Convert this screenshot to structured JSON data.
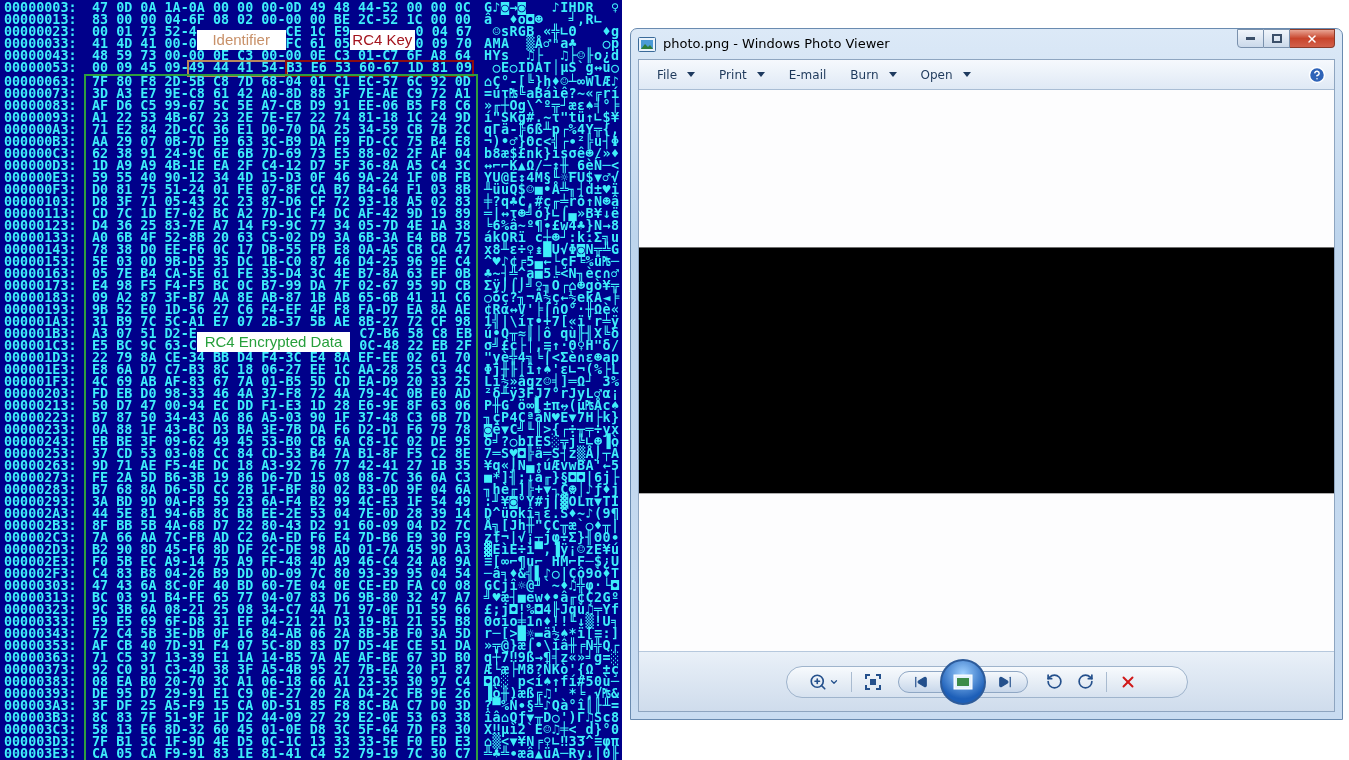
{
  "hex_dump": {
    "rows": [
      {
        "offset": "00000003:",
        "hex": "47 0D 0A 1A-0A 00 00 00-0D 49 48 44-52 00 00 0C",
        "ascii": "G♪◙→◙   ♪IHDR  ♀"
      },
      {
        "offset": "00000013:",
        "hex": "83 00 00 04-6F 08 02 00-00 00 BE 2C-52 1C 00 00",
        "ascii": "â  ♦o◘☻   ╛,R∟  "
      },
      {
        "offset": "00000023:",
        "hex": [
          {
            "kind": "text",
            "text": "00 01 73 52-4"
          },
          {
            "kind": "label",
            "text": "Identifier",
            "color": "#c89068"
          },
          {
            "kind": "text",
            "text": "CE 1C E9"
          },
          {
            "kind": "label",
            "text": "RC4 Key",
            "color": "#a3121c"
          },
          {
            "kind": "text",
            "text": "0 04 67"
          }
        ],
        "ascii": " ☺sRGB «╬∟Θ   ♦g"
      },
      {
        "offset": "00000033:",
        "hex": [
          {
            "kind": "text",
            "text": "41 4D 41 00-0"
          },
          {
            "kind": "covered"
          },
          {
            "kind": "text",
            "text": "FC 61 05"
          },
          {
            "kind": "covered"
          },
          {
            "kind": "text",
            "text": "0 09 70"
          }
        ],
        "ascii": "AMA  ▒Å♂ⁿa♣   ○p"
      },
      {
        "offset": "00000043:",
        "hex": "48 59 73 00-00 0E C3 00-00 0E C3 01-C7 6F A8 64",
        "ascii": "HYs  ♫├  ♫├☺╟o¿d"
      },
      {
        "offset": "00000053:",
        "hex": [
          {
            "kind": "text",
            "text": "00 09 45 09-"
          },
          {
            "kind": "boxed",
            "text": "49 44 41 54-",
            "color": "#b8875c"
          },
          {
            "kind": "boxed",
            "text": "B3 E6 53 60-67 1D 81 09",
            "color": "#8b0d12"
          }
        ],
        "ascii": " ○E○IDAT│µS`g↔ü○"
      },
      {
        "offset": "00000063:",
        "hex": "7F 80 F8 2D-5B C8 7D 68-04 01 C1 EC-57 6C 92 0D",
        "ascii": "⌂Ç°-[╚}h♦☺┴∞WlÆ♪"
      },
      {
        "offset": "00000073:",
        "hex": "3D A3 E7 9E-C8 61 42 A0-8D 88 3F 7E-AE C9 72 A1",
        "ascii": "=úτ₧╚aBáìê?~«╔rí"
      },
      {
        "offset": "00000083:",
        "hex": "AF D6 C5 99-67 5C 5E A7-CB D9 91 EE-06 B5 F8 C6",
        "ascii": "»╓┼Ög\\^º╦┘æε♠╡°╞"
      },
      {
        "offset": "00000093:",
        "hex": "A1 22 53 4B-67 23 2E 7E-E7 22 74 81-18 1C 24 9D",
        "ascii": "í\"SKg#.~τ\"tü↑∟$¥"
      },
      {
        "offset": "000000A3:",
        "hex": "71 E2 84 2D-CC 36 E1 D0-70 DA 25 34-59 CB 7B 2C",
        "ascii": "qΓä-╠6ß╨p┌%4Y╦{,"
      },
      {
        "offset": "000000B3:",
        "hex": "AA 29 07 0B-7D E9 63 3C-B9 DA F9 FD-CC 75 B4 E8",
        "ascii": "¬)•♂}Θc<╣┌∙²╠u┤Φ"
      },
      {
        "offset": "000000C3:",
        "hex": "62 38 91 24-9C 6E 6B 7D-69 73 E5 88-02 2F AF 04",
        "ascii": "b8æ$£nk}isσê☻/»♦"
      },
      {
        "offset": "000000D3:",
        "hex": "1D A9 A9 4B-1E EA 2F C4-12 D7 5F 36-8A A5 C4 3C",
        "ascii": "↔⌐⌐K▲Ω/─↕╫_6èÑ─<"
      },
      {
        "offset": "000000E3:",
        "hex": "59 55 40 90-12 34 4D 15-D3 0F 46 9A-24 1F 0B FB",
        "ascii": "YU@É↕4M§╙☼FÜ$▼♂√"
      },
      {
        "offset": "000000F3:",
        "hex": "D0 81 75 51-24 01 FE 07-8F CA B7 B4-64 F1 03 8B",
        "ascii": "╨üuQ$☺■•Å╩╖┤d±♥ï"
      },
      {
        "offset": "00000103:",
        "hex": "D8 3F 71 05-43 2C 23 87-D6 CF 72 93-18 A5 02 83",
        "ascii": "╪?q♣C,#ç╓╧rô↑Ñ☻â"
      },
      {
        "offset": "00000113:",
        "hex": "CD 7C 1D E7-02 BC A2 7D-1C F4 DC AF-42 9D 19 89",
        "ascii": "═|↔τ☻╝ó}∟⌠▄»B¥↓ë"
      },
      {
        "offset": "00000123:",
        "hex": "D4 36 25 83-7E A7 14 F9-9C 77 34 05-7D 4E 1A 38",
        "ascii": "╘6%â~º¶∙£w4♣}N→8"
      },
      {
        "offset": "00000133:",
        "hex": "A0 6B 4F 52-8B 20 63 C5-02 D9 3A 6B-3A E4 BB 75",
        "ascii": "ákORï c┼☻┘:k:Σ╗u"
      },
      {
        "offset": "00000143:",
        "hex": "78 38 D0 EE-F6 0C 17 DB-55 FB E8 0A-A5 CB CA 47",
        "ascii": "x8╨ε÷♀↨█U√Φ◙Ñ╦╩G"
      },
      {
        "offset": "00000153:",
        "hex": "5E 03 0D 9B-D5 35 DC 1B-C0 87 46 D4-25 96 9E C4",
        "ascii": "^♥♪¢╒5▄←└çF╘%û₧─"
      },
      {
        "offset": "00000163:",
        "hex": "05 7E B4 CA-5E 61 FE 35-D4 3C 4E B7-8A 63 EF 0B",
        "ascii": "♣~┤╩^a■5╘<N╖èc∩♂"
      },
      {
        "offset": "00000173:",
        "hex": "E4 98 F5 F4-F5 BC 0C B7-99 DA 7F 02-67 95 9D CB",
        "ascii": "Σÿ⌡⌠⌡╝♀╖Ö┌⌂☻gò¥╦"
      },
      {
        "offset": "00000183:",
        "hex": "09 A2 87 3F-B7 AA 8E AB-87 1B AB 65-6B 41 11 C6",
        "ascii": "○óç?╖¬Ä½ç←½ekA◄╞"
      },
      {
        "offset": "00000193:",
        "hex": "9B 52 E0 1D-56 27 C6 F4-EF 4F F8 FA-D7 EA 8A AE",
        "ascii": "¢Rα↔V'╞⌠∩O°·╫Ωè«"
      },
      {
        "offset": "000001A3:",
        "hex": "31 B9 7C 5C-A1 E7 07 2B-37 5B AE 8B-27 72 CF 98",
        "ascii": "1╣|\\íτ•+7[«ï'r╧ÿ"
      },
      {
        "offset": "000001B3:",
        "hex": [
          {
            "kind": "text",
            "text": "A3 07 51 D2-E"
          },
          {
            "kind": "label",
            "text": "RC4 Encrypted Data",
            "color": "#27a03c"
          },
          {
            "kind": "text",
            "text": "C7-B6 58 C8 EB"
          }
        ],
        "ascii": "ú•Q╥≈║│ô qù╟╢X╚δ"
      },
      {
        "offset": "000001C3:",
        "hex": [
          {
            "kind": "text",
            "text": "E5 BC 9C 63-C"
          },
          {
            "kind": "covered"
          },
          {
            "kind": "text",
            "text": "0C-48 22 EB 2F"
          }
        ],
        "ascii": "σ╝£c├│,≡↑·Θ♀H\"δ/"
      },
      {
        "offset": "000001D3:",
        "hex": "22 79 8A CE-34 BB D4 F4-3C E4 8A EF-EE 02 61 70",
        "ascii": "\"yè╬4╗╘⌠<Σè∩ε☻ap"
      },
      {
        "offset": "000001E3:",
        "hex": "E8 6A D7 C7-B3 8C 18 06-27 EE 1C AA-28 25 C3 4C",
        "ascii": "Φj╫╟│î↑♠'ε∟¬(%├L"
      },
      {
        "offset": "000001F3:",
        "hex": "4C 69 AB AF-83 67 7A 01-B5 5D CD EA-D9 20 33 25",
        "ascii": "Li½»âgz☺╡]═Ω┘ 3%"
      },
      {
        "offset": "00000203:",
        "hex": "FD EB D0 98-33 46 4A 37-F8 72 4A 79-4C 0B E0 AD",
        "ascii": "²δ╨ÿ3FJ7°rJyL♂α¡"
      },
      {
        "offset": "00000213:",
        "hex": "50 D7 47 00-94 EC DD F1-E3 1D 28 E6-9E 8F 63 06",
        "ascii": "P╫G ö∞▌±π↔(µ₧Åc♠"
      },
      {
        "offset": "00000223:",
        "hex": "B7 87 50 34-43 A6 86 A5-03 90 1F 37-48 C3 6B 7D",
        "ascii": "╖çP4CªåÑ♥É▼7H├k}"
      },
      {
        "offset": "00000233:",
        "hex": "0A 88 1F 43-BC D3 BA 3E-7B DA F6 D2-D1 F6 79 78",
        "ascii": "◙ê▼C╝╙║>{┌÷╥╤÷yx"
      },
      {
        "offset": "00000243:",
        "hex": "EB BE 3F 09-62 49 45 53-B0 CB 6A C8-1C 02 DE 95",
        "ascii": "δ╛?○bIES░╦j╚∟☻▐ò"
      },
      {
        "offset": "00000253:",
        "hex": "37 CD 53 03-08 CC 84 CD-53 B4 7A B1-8F F5 C2 8E",
        "ascii": "7═S♥◘╠ä═S┤z▒Å⌡┬Ä"
      },
      {
        "offset": "00000263:",
        "hex": "9D 71 AE F5-4E DC 18 A3-92 76 77 42-41 27 1B 35",
        "ascii": "¥q«⌡N▄↑úÆvwBA'←5"
      },
      {
        "offset": "00000273:",
        "hex": "FE 2A 5D B6-3B 19 86 D6-7D 15 08 08-7C 36 6A C3",
        "ascii": "■*]╢;↓å╓}§◘◘|6j├"
      },
      {
        "offset": "00000283:",
        "hex": "B7 68 8A D6-5D CC 2B 1F-BF 80 02 B3-0D 9F 04 6A",
        "ascii": "╖hè╓]╠+▼┐Ç☻│♪ƒ♦j"
      },
      {
        "offset": "00000293:",
        "hex": "3A BD 9D 0A-F8 59 23 6A-F4 B2 99 4C-E3 1F 54 49",
        "ascii": ":╜¥◙°Y#j⌠▓ÖLπ▼TI"
      },
      {
        "offset": "000002A3:",
        "hex": "44 5E 81 94-6B 8C B8 EE-2E 53 04 7E-0D 28 39 14",
        "ascii": "D^üökî╕ε.S♦~♪(9¶"
      },
      {
        "offset": "000002B3:",
        "hex": "8F BB 5B 4A-68 D7 22 80-43 D2 91 60-09 04 D2 7C",
        "ascii": "Å╗[Jh╫\"ÇC╥æ`○♦╥|"
      },
      {
        "offset": "000002C3:",
        "hex": "7A 66 AA 7C-FB AD C2 6A-ED F6 E4 7D-B6 E9 30 F9",
        "ascii": "zf¬|√¡┬jφ÷Σ}╢Θ0∙"
      },
      {
        "offset": "000002D3:",
        "hex": "B2 90 8D 45-F6 8D DF 2C-DE 98 AD 01-7A 45 9D A3",
        "ascii": "▓ÉìE÷ì▀,▐ÿ¡☺zE¥ú"
      },
      {
        "offset": "000002E3:",
        "hex": "F0 5B EC A9-14 75 A9 FF-48 4D A9 46-C4 24 A8 9A",
        "ascii": "≡[∞⌐¶u⌐ HM⌐F─$¿Ü"
      },
      {
        "offset": "000002F3:",
        "hex": "C4 83 B8 04-26 B9 DD 0D-09 7C 80 93-39 95 04 54",
        "ascii": "─â╕♦&╣▌♪○|Çô9ò♦T"
      },
      {
        "offset": "00000303:",
        "hex": "47 43 6A 8C-0F 40 BD 60-7E 04 0E CE-ED FA C0 08",
        "ascii": "GCjî☼@╜`~♦♫╬φ·└◘"
      },
      {
        "offset": "00000313:",
        "hex": "BC 03 91 B4-FE 65 77 04-07 83 D6 9B-80 32 47 A7",
        "ascii": "╝♥æ┤■ew♦•â╓¢Ç2Gº"
      },
      {
        "offset": "00000323:",
        "hex": "9C 3B 6A 08-21 25 08 34-C7 4A 71 97-0E D1 59 66",
        "ascii": "£;j◘!%◘4╟Jqù♫╤Yf"
      },
      {
        "offset": "00000333:",
        "hex": "E9 E5 69 6F-D8 31 EF 04-21 21 D3 19-B1 21 55 B8",
        "ascii": "Θσio╪1∩♦!!╙↓▒!U╕"
      },
      {
        "offset": "00000343:",
        "hex": "72 C4 5B 3E-DB 0F 16 84-AB 06 2A 8B-5B F0 3A 5D",
        "ascii": "r─[>█☼▬ä½♠*ï[≡:]"
      },
      {
        "offset": "00000353:",
        "hex": "AF CB 40 7D-91 F4 07 5C-8D 83 D7 D5-4E CE 51 DA",
        "ascii": "»╦@}æ⌠•\\ìâ╫╒N╬Q┌"
      },
      {
        "offset": "00000363:",
        "hex": "71 C5 37 13-39 E1 1A 14-B5 7A AE AF-BE 67 3D B0",
        "ascii": "q┼7‼9ß→¶╡z«»╛g=░"
      },
      {
        "offset": "00000373:",
        "hex": "92 C0 91 C3-4D 38 3F A5-4B 95 27 7B-EA 20 F1 87",
        "ascii": "Æ└æ├M8?ÑKò'{Ω ±ç"
      },
      {
        "offset": "00000383:",
        "hex": "08 EA B0 20-70 3C A1 06-18 66 A1 23-35 30 97 C4",
        "ascii": "◘Ω░ p<í♠↑fí#50ù─"
      },
      {
        "offset": "00000393:",
        "hex": "DE 95 D7 29-91 E1 C9 0E-27 20 2A D4-2C FB 9E 26",
        "ascii": "▐ò╫)æß╔♫' *╘,√₧&"
      },
      {
        "offset": "000003A3:",
        "hex": "3F DF 25 A5-F9 15 CA 0D-51 85 F8 8C-BA C7 D0 3D",
        "ascii": "?▀%Ñ∙§╩♪Qà°î║╟╨="
      },
      {
        "offset": "000003B3:",
        "hex": "8C 83 7F 51-9F 1F D2 44-09 27 29 E2-0E 53 63 38",
        "ascii": "îâ⌂Qƒ▼╥D○')Γ♫Sc8"
      },
      {
        "offset": "000003C3:",
        "hex": "58 13 E6 8D-32 60 45 01-0E D8 3C 5F-64 7D F8 30",
        "ascii": "X‼µì2`E☺♫╪<_d}°0"
      },
      {
        "offset": "000003D3:",
        "hex": "7F B1 3C 1F-9D 4E D5 0C-1C 13 33 33-5E F0 ED E3",
        "ascii": "⌂▒<▼¥N╒♀∟‼33^≡φπ"
      },
      {
        "offset": "000003E3:",
        "hex": "CA 05 CA F9-91 83 1E 81-41 C4 52 79-19 7C 30 C7",
        "ascii": "╩♣╩∙æâ▲üA─Ry↓|0╟"
      }
    ]
  },
  "viewer": {
    "title": "photo.png - Windows Photo Viewer",
    "menu": [
      {
        "label": "File",
        "dropdown": true
      },
      {
        "label": "Print",
        "dropdown": true
      },
      {
        "label": "E-mail",
        "dropdown": false
      },
      {
        "label": "Burn",
        "dropdown": true
      },
      {
        "label": "Open",
        "dropdown": true
      }
    ]
  }
}
